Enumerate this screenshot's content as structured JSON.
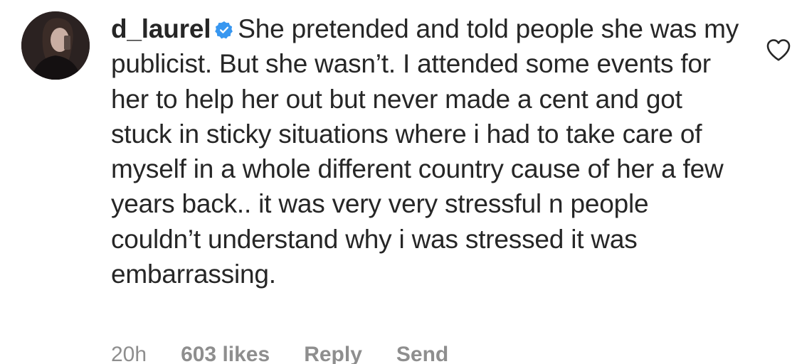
{
  "comment": {
    "username": "d_laurel",
    "verified": true,
    "text": "She pretended and told people she was my publicist. But she wasn’t. I attended some events for her to help her out but never made a cent and got stuck in sticky situations where i had to take care of myself in a whole different country cause of her a few years back.. it was very very stressful n people couldn’t understand why i was stressed it was embarrassing.",
    "meta": {
      "time": "20h",
      "likes": "603 likes",
      "reply": "Reply",
      "send": "Send"
    }
  },
  "icons": {
    "verified": "verified-badge-icon",
    "like": "heart-outline-icon"
  },
  "colors": {
    "text": "#262626",
    "meta": "#8e8e8e",
    "verified_blue": "#3897f0"
  }
}
